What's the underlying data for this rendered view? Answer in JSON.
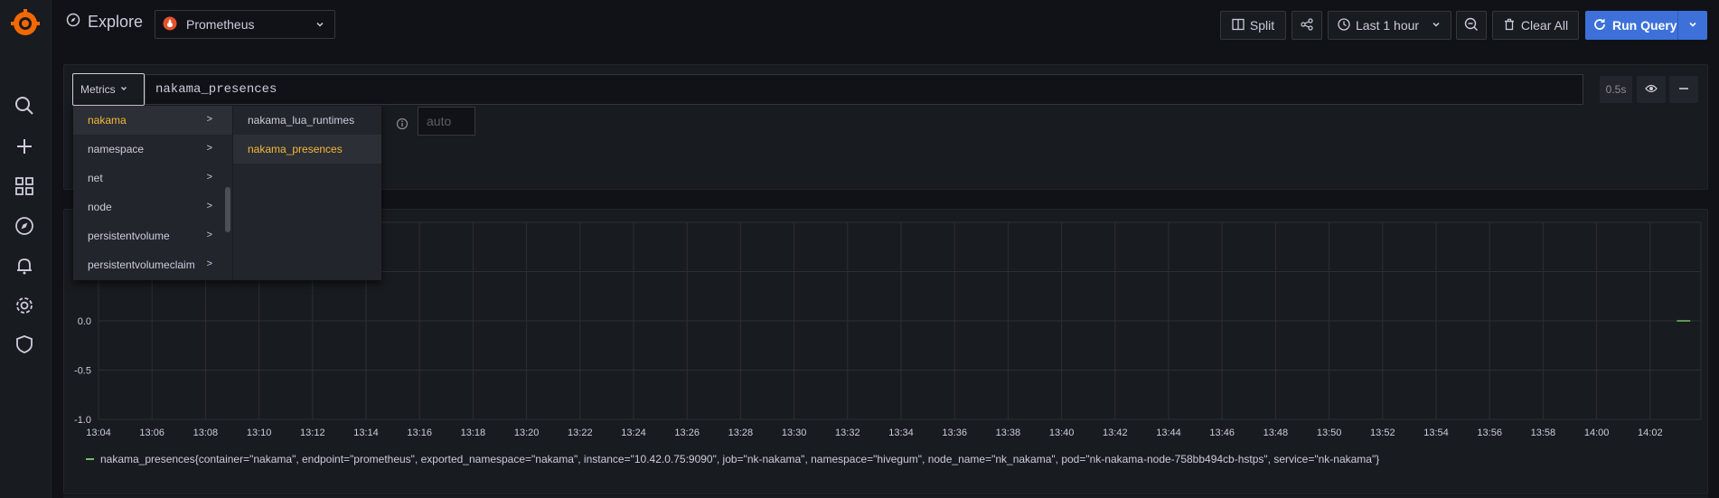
{
  "topbar": {
    "title": "Explore",
    "datasource": "Prometheus",
    "split_label": "Split",
    "time_range": "Last 1 hour",
    "clear_label": "Clear All",
    "run_label": "Run Query"
  },
  "query": {
    "metrics_label": "Metrics",
    "expression": "nakama_presences",
    "duration": "0.5s",
    "step_placeholder": "auto"
  },
  "cascader": {
    "col1": [
      {
        "label": "nakama",
        "active": true
      },
      {
        "label": "namespace",
        "active": false
      },
      {
        "label": "net",
        "active": false
      },
      {
        "label": "node",
        "active": false
      },
      {
        "label": "persistentvolume",
        "active": false
      },
      {
        "label": "persistentvolumeclaim",
        "active": false
      }
    ],
    "col2": [
      {
        "label": "nakama_lua_runtimes",
        "active": false
      },
      {
        "label": "nakama_presences",
        "active": true
      }
    ]
  },
  "colors": {
    "accent": "#3d71d9",
    "highlight": "#f5b73b",
    "series": "#73bf69",
    "prometheus": "#e6522c"
  },
  "chart_data": {
    "type": "line",
    "x": [
      "13:04",
      "13:06",
      "13:08",
      "13:10",
      "13:12",
      "13:14",
      "13:16",
      "13:18",
      "13:20",
      "13:22",
      "13:24",
      "13:26",
      "13:28",
      "13:30",
      "13:32",
      "13:34",
      "13:36",
      "13:38",
      "13:40",
      "13:42",
      "13:44",
      "13:46",
      "13:48",
      "13:50",
      "13:52",
      "13:54",
      "13:56",
      "13:58",
      "14:00",
      "14:02"
    ],
    "ylim": [
      -1.0,
      1.0
    ],
    "yticks": [
      "0.5",
      "0.0",
      "-0.5",
      "-1.0"
    ],
    "grid": true,
    "legend_placement": "bottom-left",
    "series": [
      {
        "name": "nakama_presences{container=\"nakama\", endpoint=\"prometheus\", exported_namespace=\"nakama\", instance=\"10.42.0.75:9090\", job=\"nk-nakama\", namespace=\"hivegum\", node_name=\"nk_nakama\", pod=\"nk-nakama-node-758bb494cb-hstps\", service=\"nk-nakama\"}",
        "points": [
          {
            "x": "14:03",
            "y": 0
          },
          {
            "x": "14:03:30",
            "y": 0
          }
        ]
      }
    ]
  }
}
